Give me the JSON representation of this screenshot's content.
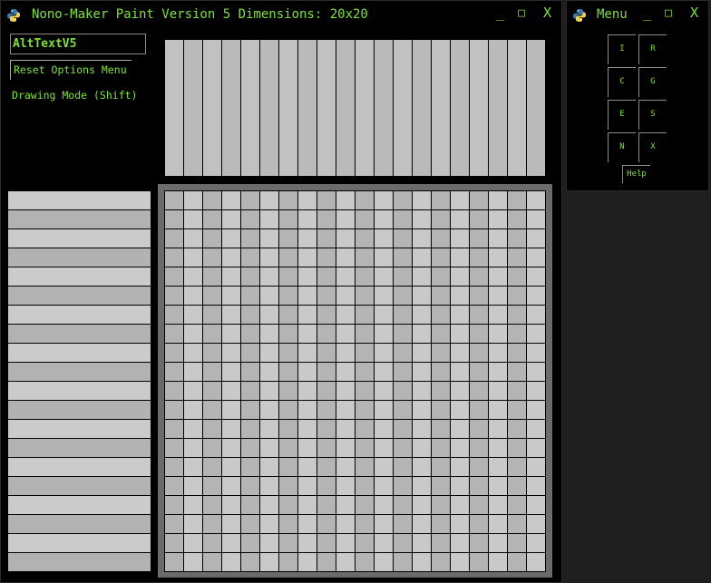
{
  "main_window": {
    "title": "Nono-Maker Paint Version 5 Dimensions: 20x20",
    "controls": {
      "minimize": "_",
      "maximize": "□",
      "close": "X"
    }
  },
  "editor": {
    "name_value": "AltTextV5",
    "reset_label": "Reset Options Menu",
    "mode_label": "Drawing Mode (Shift)"
  },
  "grid": {
    "rows": 20,
    "cols": 20
  },
  "menu_window": {
    "title": "Menu",
    "controls": {
      "minimize": "_",
      "maximize": "□",
      "close": "X"
    },
    "buttons": [
      "I",
      "R",
      "C",
      "G",
      "E",
      "S",
      "N",
      "X"
    ],
    "help_label": "Help"
  },
  "colors": {
    "accent": "#7fe03a",
    "window_bg": "#000000",
    "grid_frame": "#6b6b6b",
    "cell_light": "#c9c9c9",
    "cell_dark": "#b4b4b4"
  }
}
